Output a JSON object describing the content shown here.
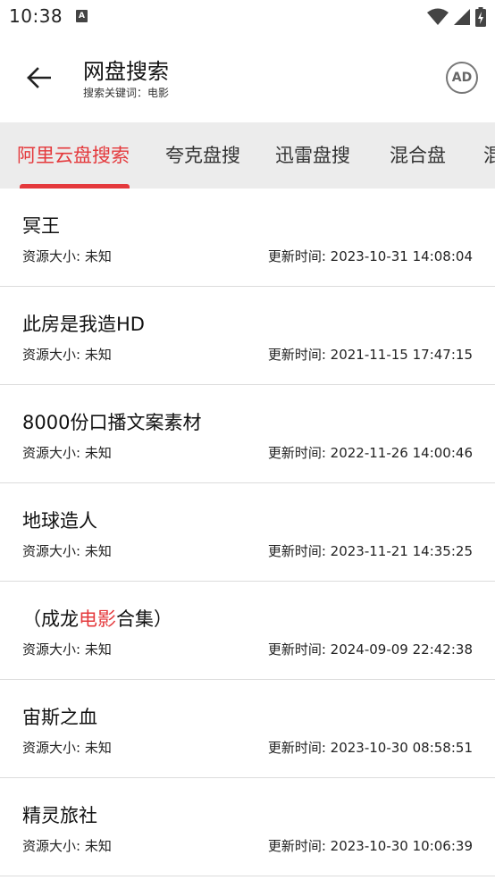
{
  "status_bar": {
    "time": "10:38",
    "notification_glyph": "A",
    "icons": [
      "wifi-icon",
      "signal-icon",
      "battery-icon"
    ]
  },
  "app_bar": {
    "title": "网盘搜索",
    "subtitle": "搜索关键词：电影",
    "ad_label": "AD",
    "back_icon": "arrow-left-icon"
  },
  "tabs": [
    {
      "label": "阿里云盘搜索",
      "active": true
    },
    {
      "label": "夸克盘搜",
      "active": false
    },
    {
      "label": "迅雷盘搜",
      "active": false
    },
    {
      "label": "混合盘",
      "active": false
    },
    {
      "label": "混",
      "active": false
    }
  ],
  "colors": {
    "accent": "#e4393c",
    "tab_bar_bg": "#ececec",
    "divider": "#dcdcdc"
  },
  "results": [
    {
      "title_before": "冥王",
      "title_highlight": "",
      "title_after": "",
      "size": "资源大小: 未知",
      "time": "更新时间: 2023-10-31 14:08:04"
    },
    {
      "title_before": "此房是我造HD",
      "title_highlight": "",
      "title_after": "",
      "size": "资源大小: 未知",
      "time": "更新时间: 2021-11-15 17:47:15"
    },
    {
      "title_before": "8000份口播文案素材",
      "title_highlight": "",
      "title_after": "",
      "size": "资源大小: 未知",
      "time": "更新时间: 2022-11-26 14:00:46"
    },
    {
      "title_before": "地球造人",
      "title_highlight": "",
      "title_after": "",
      "size": "资源大小: 未知",
      "time": "更新时间: 2023-11-21 14:35:25"
    },
    {
      "title_before": "（成龙",
      "title_highlight": "电影",
      "title_after": "合集）",
      "size": "资源大小: 未知",
      "time": "更新时间: 2024-09-09 22:42:38"
    },
    {
      "title_before": "宙斯之血",
      "title_highlight": "",
      "title_after": "",
      "size": "资源大小: 未知",
      "time": "更新时间: 2023-10-30 08:58:51"
    },
    {
      "title_before": "精灵旅社",
      "title_highlight": "",
      "title_after": "",
      "size": "资源大小: 未知",
      "time": "更新时间: 2023-10-30 10:06:39"
    }
  ]
}
